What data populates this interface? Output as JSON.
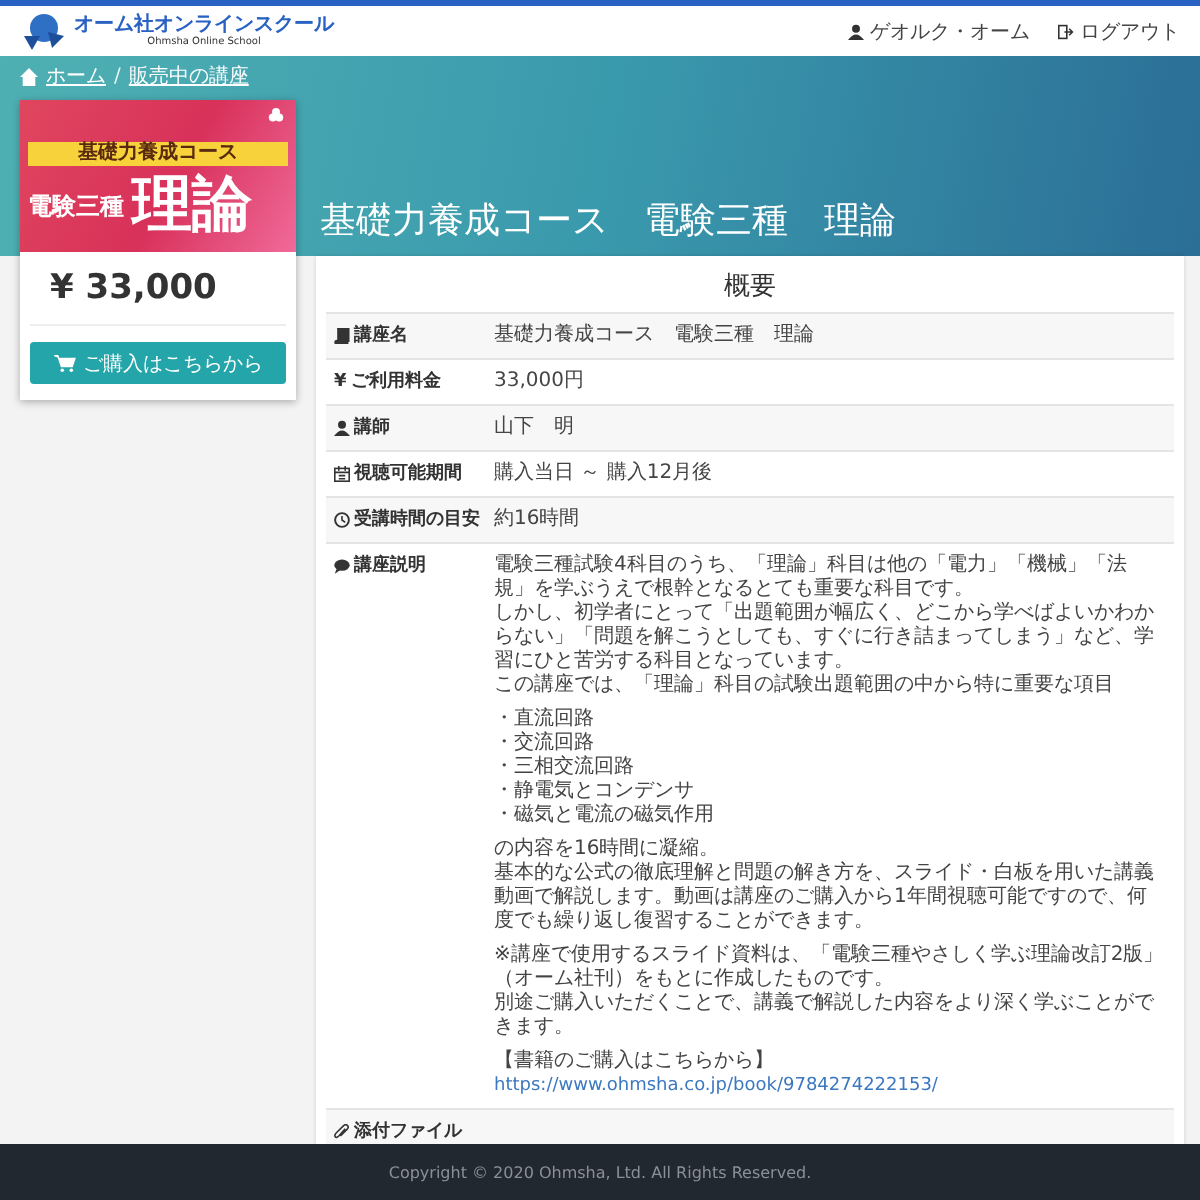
{
  "header": {
    "logo_title": "オーム社オンラインスクール",
    "logo_subtitle": "Ohmsha Online School",
    "user": "ゲオルク・オーム",
    "logout": "ログアウト"
  },
  "breadcrumb": {
    "separator": "/",
    "items": [
      "ホーム",
      "販売中の講座"
    ]
  },
  "course_image": {
    "series": "基礎力養成コース",
    "prefix": "電験三種",
    "subject": "理論"
  },
  "price": "¥ 33,000",
  "buy_button": "ご購入はこちらから",
  "title": "基礎力養成コース　電験三種　理論",
  "overview": {
    "heading": "概要",
    "rows": [
      {
        "kind": "book",
        "label": "講座名",
        "value": "基礎力養成コース　電験三種　理論"
      },
      {
        "kind": "yen",
        "glyph": "¥",
        "label": "ご利用料金",
        "value": "33,000円"
      },
      {
        "kind": "user",
        "label": "講師",
        "value": "山下　明"
      },
      {
        "kind": "calendar",
        "label": "視聴可能期間",
        "value": "購入当日 ～ 購入12月後"
      },
      {
        "kind": "clock",
        "label": "受講時間の目安",
        "value": "約16時間"
      }
    ],
    "description": {
      "kind": "comment",
      "label": "講座説明",
      "blocks": [
        {
          "kind": "text",
          "lines": [
            "電験三種試験4科目のうち、「理論」科目は他の「電力」「機械」「法規」を学ぶうえで根幹となるとても重要な科目です。",
            "しかし、初学者にとって「出題範囲が幅広く、どこから学べばよいかわからない」「問題を解こうとしても、すぐに行き詰まってしまう」など、学習にひと苦労する科目となっています。",
            "この講座では、「理論」科目の試験出題範囲の中から特に重要な項目"
          ]
        },
        {
          "kind": "list",
          "items": [
            "・直流回路",
            "・交流回路",
            "・三相交流回路",
            "・静電気とコンデンサ",
            "・磁気と電流の磁気作用"
          ]
        },
        {
          "kind": "text",
          "lines": [
            "の内容を16時間に凝縮。",
            "基本的な公式の徹底理解と問題の解き方を、スライド・白板を用いた講義動画で解説します。動画は講座のご購入から1年間視聴可能ですので、何度でも繰り返し復習することができます。"
          ]
        },
        {
          "kind": "text",
          "lines": [
            "※講座で使用するスライド資料は、「電験三種やさしく学ぶ理論改訂2版」（オーム社刊）をもとに作成したものです。",
            "別途ご購入いただくことで、講義で解説した内容をより深く学ぶことができます。"
          ]
        },
        {
          "kind": "text",
          "lines": [
            "【書籍のご購入はこちらから】"
          ]
        },
        {
          "kind": "link",
          "text": "https://www.ohmsha.co.jp/book/9784274222153/"
        }
      ]
    },
    "attachment": {
      "kind": "paperclip",
      "label": "添付ファイル"
    }
  },
  "footer": "Copyright © 2020 Ohmsha, Ltd. All Rights Reserved."
}
